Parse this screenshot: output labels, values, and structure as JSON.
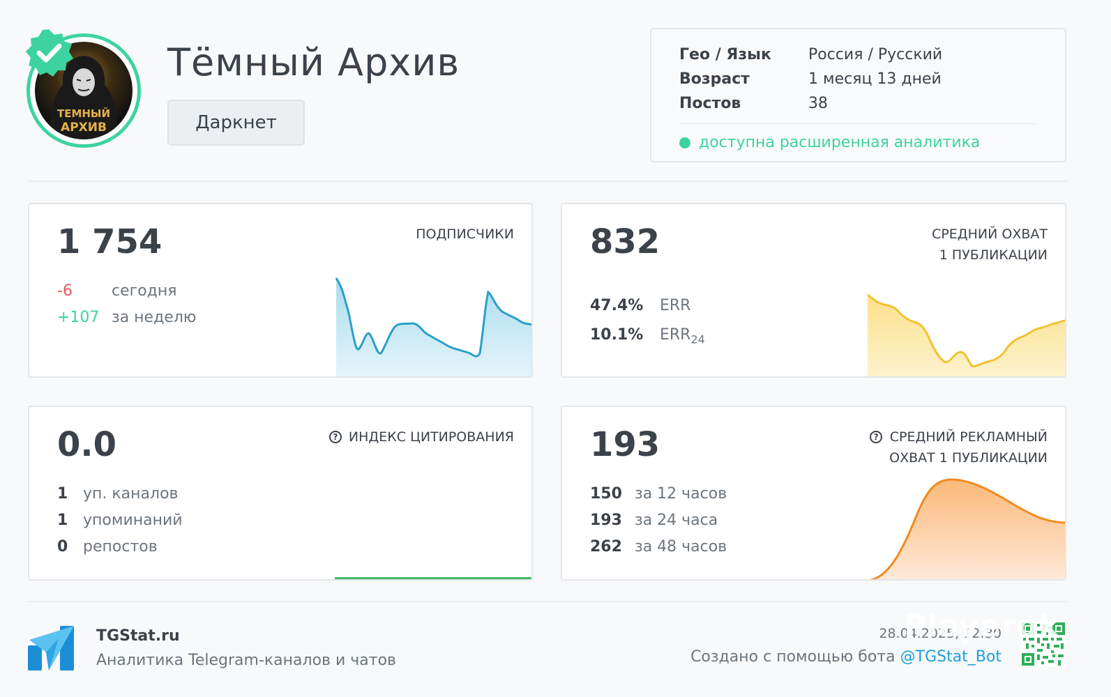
{
  "header": {
    "title": "Тёмный Архив",
    "category": "Даркнет",
    "avatar_caption": [
      "ТЕМНЫЙ",
      "АРХИВ"
    ]
  },
  "info": {
    "rows": [
      {
        "label": "Гео / Язык",
        "value": "Россия / Русский"
      },
      {
        "label": "Возраст",
        "value": "1 месяц 13 дней"
      },
      {
        "label": "Постов",
        "value": "38"
      }
    ],
    "status": "доступна расширенная аналитика"
  },
  "cards": {
    "subscribers": {
      "value": "1 754",
      "title": "ПОДПИСЧИКИ",
      "stats": [
        {
          "num": "-6",
          "label": "сегодня"
        },
        {
          "num": "+107",
          "label": "за неделю"
        }
      ]
    },
    "reach": {
      "value": "832",
      "title_line1": "СРЕДНИЙ ОХВАТ",
      "title_line2": "1 ПУБЛИКАЦИИ",
      "stats": [
        {
          "num": "47.4%",
          "label": "ERR",
          "sub": ""
        },
        {
          "num": "10.1%",
          "label": "ERR",
          "sub": "24"
        }
      ]
    },
    "citation": {
      "value": "0.0",
      "title": "ИНДЕКС ЦИТИРОВАНИЯ",
      "stats": [
        {
          "num": "1",
          "label": "уп. каналов"
        },
        {
          "num": "1",
          "label": "упоминаний"
        },
        {
          "num": "0",
          "label": "репостов"
        }
      ]
    },
    "ad_reach": {
      "value": "193",
      "title_line1": "СРЕДНИЙ РЕКЛАМНЫЙ",
      "title_line2": "ОХВАТ 1 ПУБЛИКАЦИИ",
      "stats": [
        {
          "num": "150",
          "label": "за 12 часов"
        },
        {
          "num": "193",
          "label": "за 24 часа"
        },
        {
          "num": "262",
          "label": "за 48 часов"
        }
      ]
    }
  },
  "footer": {
    "brand": "TGStat.ru",
    "subtitle": "Аналитика Telegram-каналов и чатов",
    "date": "28.04.2025, 12:30",
    "bot_prefix": "Создано с помощью бота",
    "bot_handle": "@TGStat_Bot",
    "watermark": "Playerok"
  },
  "colors": {
    "accent_green": "#3dd3a0",
    "negative_red": "#e8585d",
    "subscribers_line": "#2a9fc9",
    "reach_line": "#f2c230",
    "ad_reach_line": "#f08a1e",
    "link_blue": "#1aa0d8"
  },
  "icons": [
    "verified-badge-icon",
    "question-circle-icon",
    "tgstat-logo-icon",
    "qr-code-icon",
    "status-dot-icon"
  ]
}
